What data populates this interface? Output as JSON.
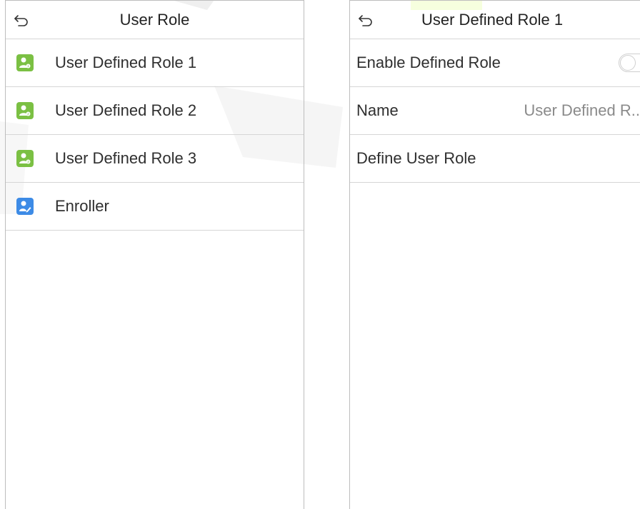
{
  "left_screen": {
    "title": "User Role",
    "items": [
      {
        "label": "User Defined Role 1",
        "icon": "user-role-1-icon",
        "icon_color": "#7bc043"
      },
      {
        "label": "User Defined Role 2",
        "icon": "user-role-2-icon",
        "icon_color": "#7bc043"
      },
      {
        "label": "User Defined Role 3",
        "icon": "user-role-3-icon",
        "icon_color": "#7bc043"
      },
      {
        "label": "Enroller",
        "icon": "enroller-icon",
        "icon_color": "#3d8be6"
      }
    ]
  },
  "right_screen": {
    "title": "User Defined Role 1",
    "rows": [
      {
        "label": "Enable Defined Role",
        "toggle_on": false
      },
      {
        "label": "Name",
        "value": "User Defined R.."
      },
      {
        "label": "Define User Role"
      }
    ]
  },
  "colors": {
    "accent_green": "#7bc043",
    "accent_blue": "#3d8be6",
    "divider": "#d6d6d6"
  }
}
